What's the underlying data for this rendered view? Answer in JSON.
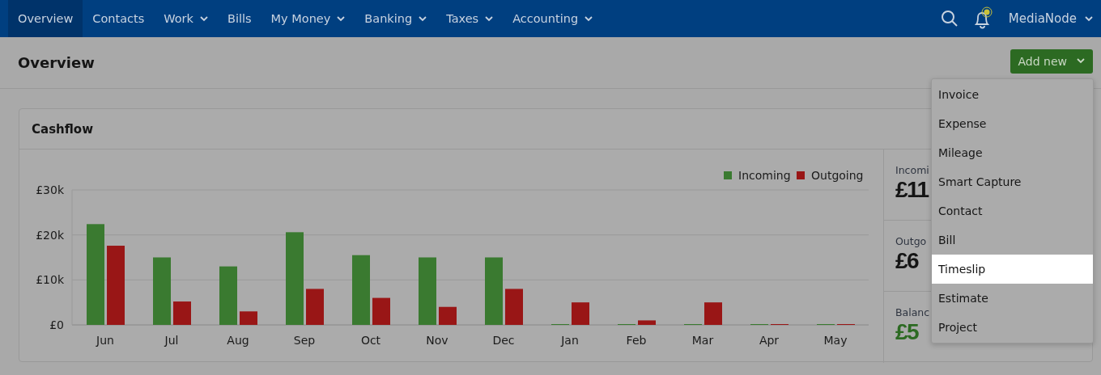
{
  "nav": {
    "items": [
      {
        "label": "Overview",
        "selected": true,
        "dropdown": false
      },
      {
        "label": "Contacts",
        "selected": false,
        "dropdown": false
      },
      {
        "label": "Work",
        "selected": false,
        "dropdown": true
      },
      {
        "label": "Bills",
        "selected": false,
        "dropdown": false
      },
      {
        "label": "My Money",
        "selected": false,
        "dropdown": true
      },
      {
        "label": "Banking",
        "selected": false,
        "dropdown": true
      },
      {
        "label": "Taxes",
        "selected": false,
        "dropdown": true
      },
      {
        "label": "Accounting",
        "selected": false,
        "dropdown": true
      }
    ],
    "notification": true,
    "account": "MediaNode"
  },
  "header": {
    "title": "Overview",
    "add_button": "Add new"
  },
  "menu": {
    "items": [
      {
        "label": "Invoice",
        "selected": false
      },
      {
        "label": "Expense",
        "selected": false
      },
      {
        "label": "Mileage",
        "selected": false
      },
      {
        "label": "Smart Capture",
        "selected": false
      },
      {
        "label": "Contact",
        "selected": false
      },
      {
        "label": "Bill",
        "selected": false
      },
      {
        "label": "Timeslip",
        "selected": true
      },
      {
        "label": "Estimate",
        "selected": false
      },
      {
        "label": "Project",
        "selected": false
      }
    ]
  },
  "cashflow": {
    "title": "Cashflow",
    "chart_data": {
      "type": "bar",
      "categories": [
        "Jun",
        "Jul",
        "Aug",
        "Sep",
        "Oct",
        "Nov",
        "Dec",
        "Jan",
        "Feb",
        "Mar",
        "Apr",
        "May"
      ],
      "series": [
        {
          "name": "Incoming",
          "color": "#3a7a30",
          "values": [
            22400,
            15000,
            13000,
            20600,
            15500,
            15000,
            15000,
            0,
            0,
            0,
            0,
            0
          ]
        },
        {
          "name": "Outgoing",
          "color": "#991616",
          "values": [
            17600,
            5200,
            3000,
            8000,
            6000,
            4000,
            8000,
            5000,
            1000,
            5000,
            0,
            0
          ]
        }
      ],
      "legend": true,
      "ylim": [
        0,
        30000
      ],
      "yticks": [
        {
          "value": 0,
          "label": "£0"
        },
        {
          "value": 10000,
          "label": "£10k"
        },
        {
          "value": 20000,
          "label": "£20k"
        },
        {
          "value": 30000,
          "label": "£30k"
        }
      ]
    },
    "stats": [
      {
        "kind": "plain",
        "label": "Incomi",
        "value": "£11"
      },
      {
        "kind": "plain",
        "label": "Outgo",
        "value": "£6"
      },
      {
        "kind": "positive",
        "label": "Balanc",
        "value": "£5"
      }
    ]
  }
}
